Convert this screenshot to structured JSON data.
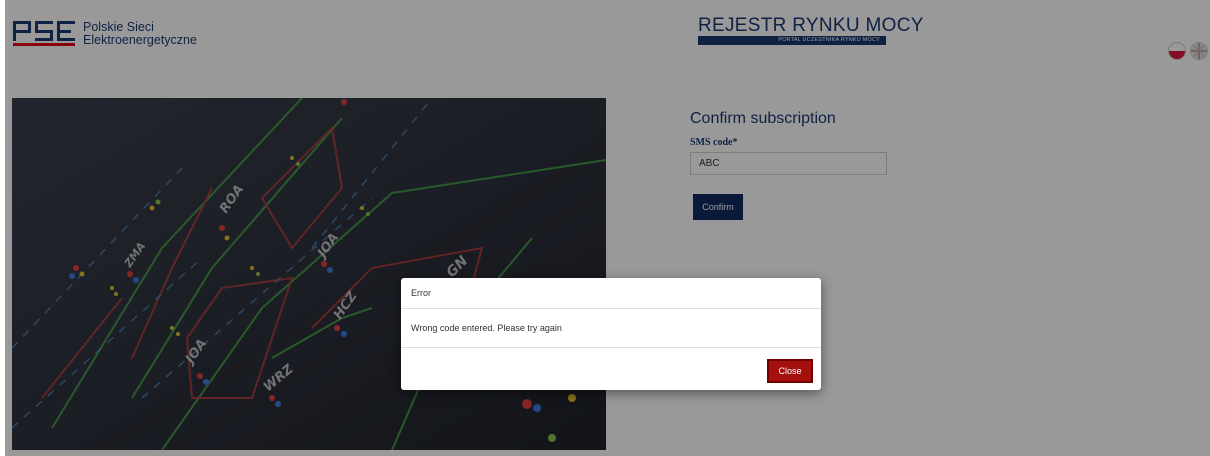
{
  "header": {
    "logo": {
      "mark": "PSE",
      "line1": "Polskie Sieci",
      "line2": "Elektroenergetyczne"
    },
    "register": {
      "title": "REJESTR RYNKU MOCY",
      "subtitle": "PORTAL UCZESTNIKA RYNKU MOCY"
    },
    "languages": [
      {
        "code": "pl",
        "icon": "poland-flag-icon"
      },
      {
        "code": "en",
        "icon": "uk-flag-icon"
      }
    ]
  },
  "hero": {
    "icon": "grid-diagram-photo"
  },
  "form": {
    "title": "Confirm subscription",
    "sms_label": "SMS code*",
    "sms_value": "ABC",
    "confirm_label": "Confirm"
  },
  "modal": {
    "title": "Error",
    "message": "Wrong code entered. Please try again",
    "close_label": "Close"
  },
  "colors": {
    "brand": "#1c3a72",
    "button": "#0f2a5f",
    "danger": "#a5100f"
  }
}
